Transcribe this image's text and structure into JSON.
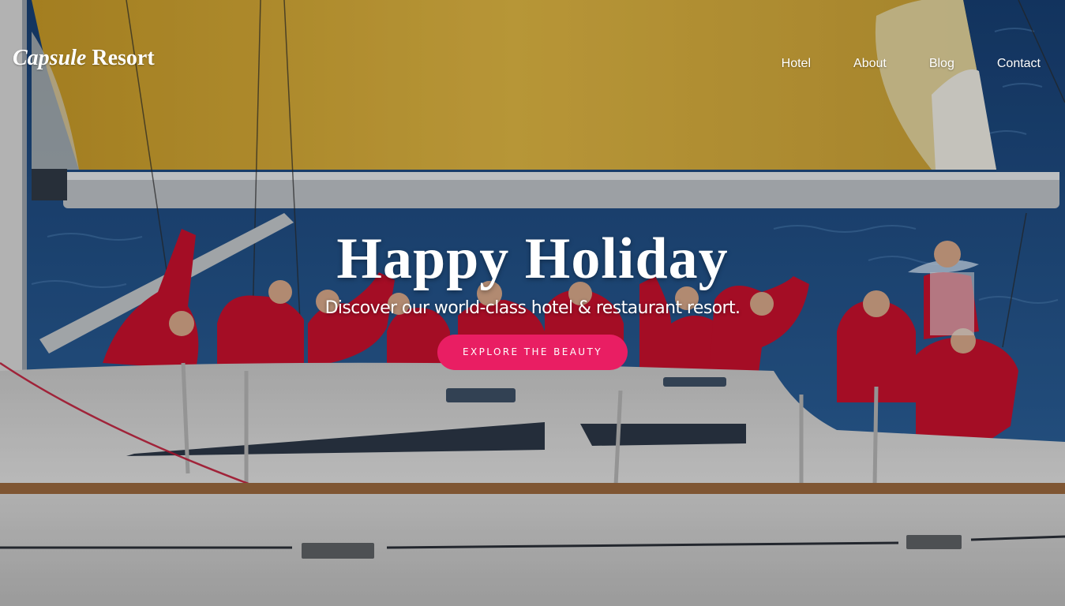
{
  "brand": {
    "name_italic": "Capsule",
    "name_rest": " Resort"
  },
  "nav": {
    "items": [
      {
        "label": "Hotel"
      },
      {
        "label": "About"
      },
      {
        "label": "Blog"
      },
      {
        "label": "Contact"
      }
    ]
  },
  "hero": {
    "title": "Happy Holiday",
    "subtitle": "Discover our world-class hotel & restaurant resort.",
    "cta_label": "Explore the beauty",
    "image_description": "sailboat-crew-at-sea"
  },
  "colors": {
    "accent": "#e91e63",
    "text": "#ffffff",
    "sail": "#d9b23a",
    "sea": "#1f4f86",
    "jackets": "#c8102e"
  }
}
